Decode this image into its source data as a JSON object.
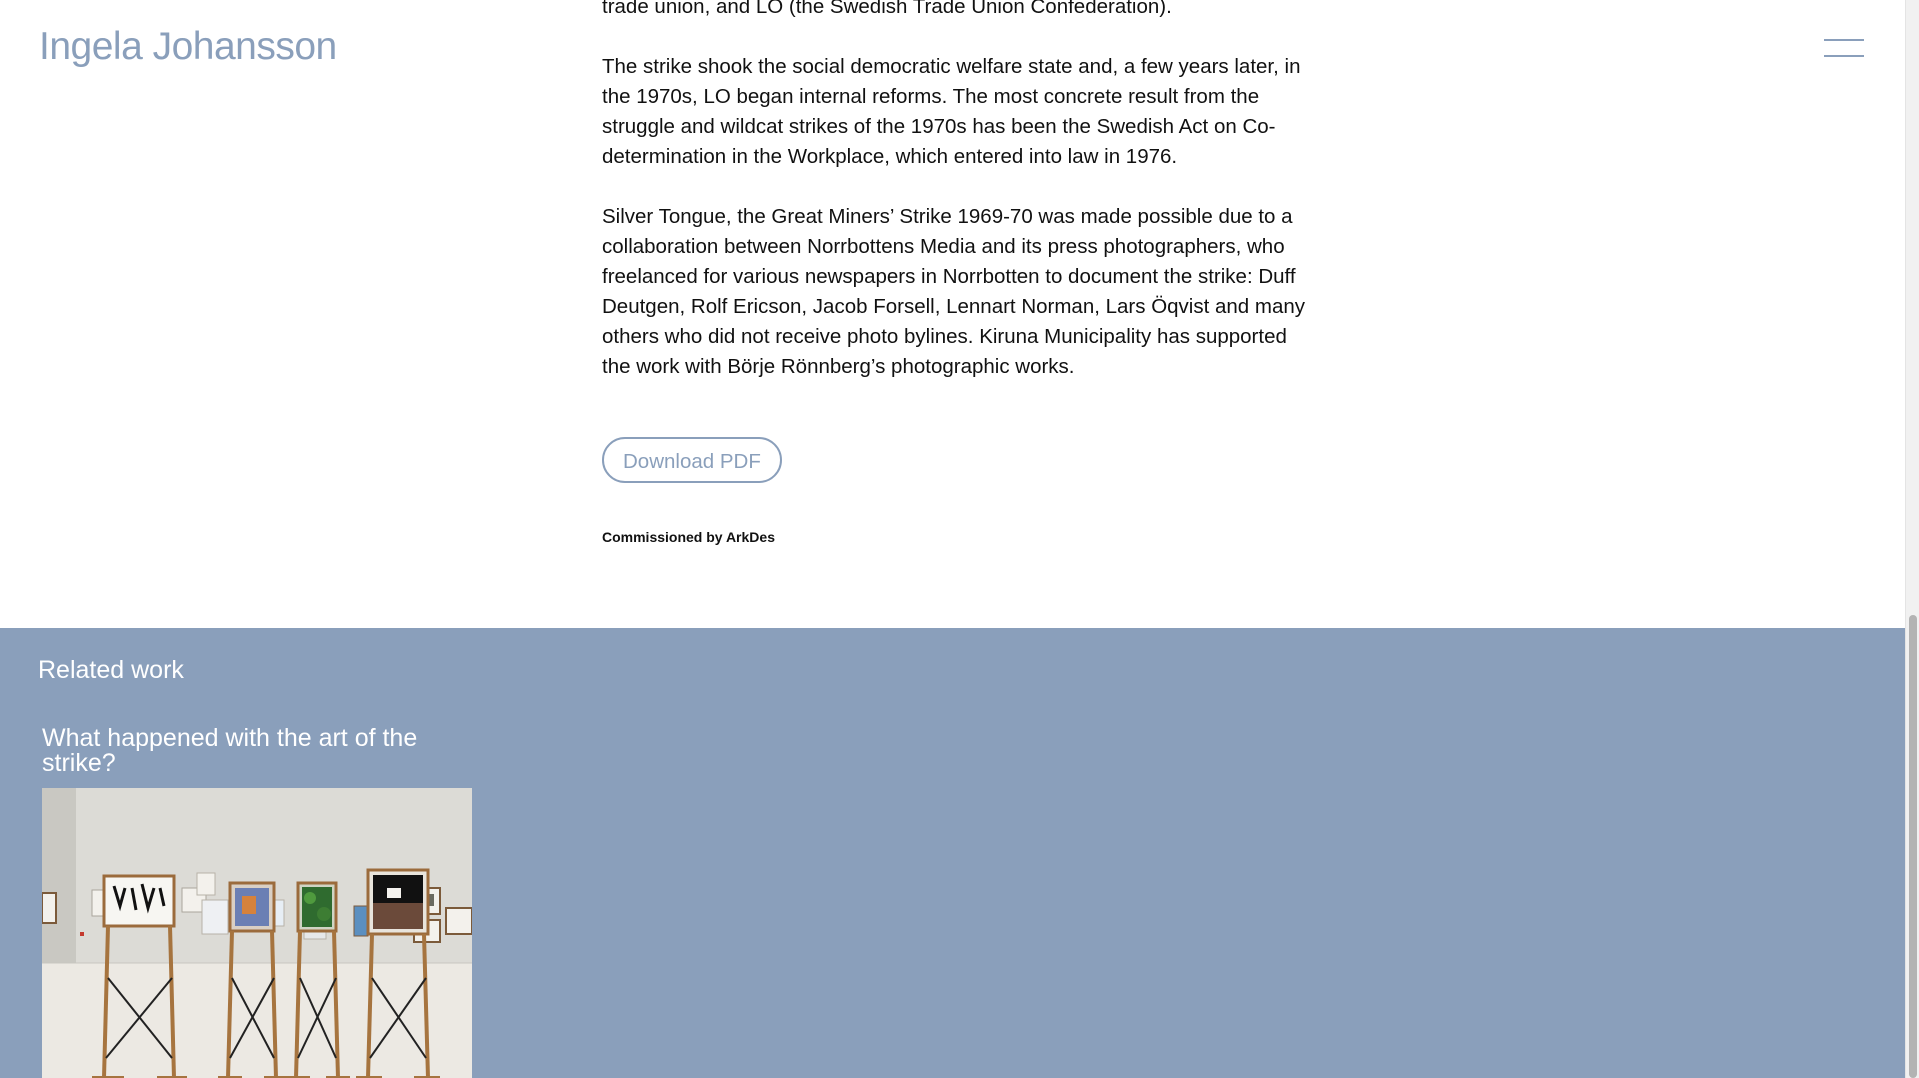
{
  "header": {
    "site_title": "Ingela Johansson",
    "menu_icon": "hamburger-menu-icon"
  },
  "article": {
    "paragraphs": [
      "a strike committee formed outside the mining company LKAB, the miners’ trade union, and LO (the Swedish Trade Union Confederation).",
      "The strike shook the social democratic welfare state and, a few years later, in the 1970s, LO began internal reforms. The most concrete result from the struggle and wildcat strikes of the 1970s has been the Swedish Act on Co-determination in the Workplace, which entered into law in 1976.",
      "Silver Tongue, the Great Miners’ Strike 1969-70 was made possible due to a collaboration between Norrbottens Media and its press photographers, who freelanced for various newspapers in Norrbotten to document the strike: Duff Deutgen, Rolf Ericson, Jacob Forsell, Lennart Norman, Lars Öqvist and many others who did not receive photo bylines. Kiruna Municipality has supported the work with Börje Rönnberg’s photographic works."
    ],
    "download_label": "Download PDF",
    "commission_text": "Commissioned by ArkDes"
  },
  "related": {
    "heading": "Related work",
    "items": [
      {
        "title": "What happened with the art of the strike?"
      }
    ]
  },
  "colors": {
    "accent": "#8a9fbb",
    "text": "#111111",
    "background": "#ffffff"
  }
}
